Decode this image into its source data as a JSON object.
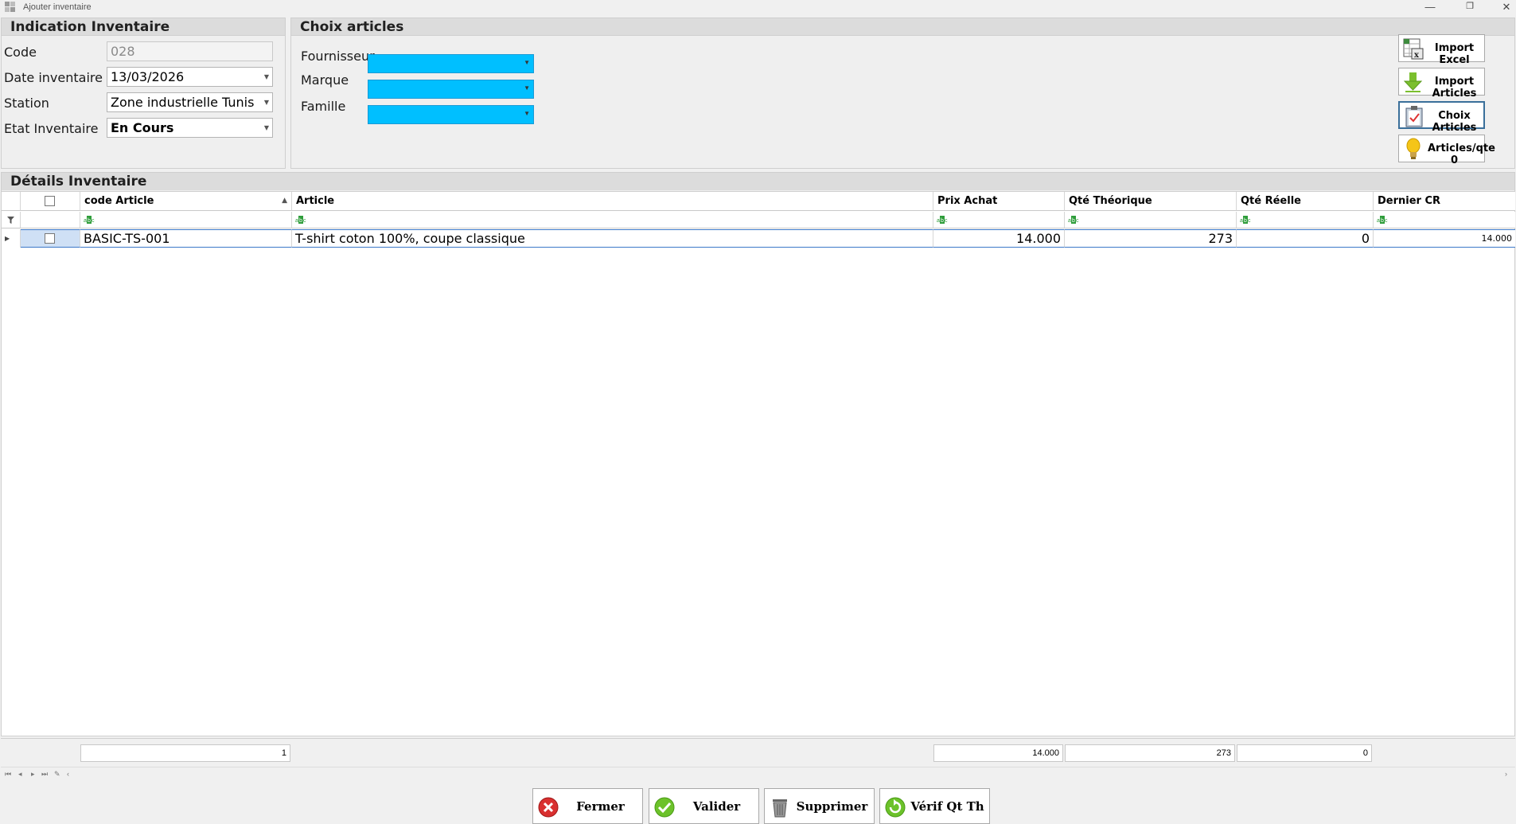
{
  "window": {
    "title": "Ajouter inventaire",
    "minimize": "—",
    "restore": "❐",
    "close": "✕"
  },
  "indication": {
    "header": "Indication Inventaire",
    "code_label": "Code",
    "code_value": "028",
    "date_label": "Date inventaire",
    "date_value": "13/03/2026",
    "station_label": "Station",
    "station_value": "Zone industrielle Tunis",
    "etat_label": "Etat Inventaire",
    "etat_value": "En Cours"
  },
  "choix": {
    "header": "Choix articles",
    "fournisseur_label": "Fournisseur",
    "marque_label": "Marque",
    "famille_label": "Famille",
    "combo_color": "#00bfff"
  },
  "side_buttons": {
    "import_excel": "Import Excel",
    "import_articles": "Import Articles",
    "choix_articles": "Choix Articles",
    "articles_qte0": "Articles/qte 0"
  },
  "details": {
    "header": "Détails Inventaire",
    "columns": {
      "code": "code Article",
      "article": "Article",
      "prix": "Prix Achat",
      "qte_theo": "Qté Théorique",
      "qte_reelle": "Qté Réelle",
      "dernier_cr": "Dernier CR"
    },
    "rows": [
      {
        "code": "BASIC-TS-001",
        "article": "T-shirt coton 100%, coupe classique",
        "prix": "14.000",
        "qte_theo": "273",
        "qte_reelle": "0",
        "dernier_cr": "14.000"
      }
    ],
    "footer": {
      "count": "1",
      "prix": "14.000",
      "qte_theo": "273",
      "qte_reelle": "0"
    }
  },
  "bottom_buttons": {
    "fermer": "Fermer",
    "valider": "Valider",
    "supprimer": "Supprimer",
    "verif": "Vérif Qt Th"
  }
}
